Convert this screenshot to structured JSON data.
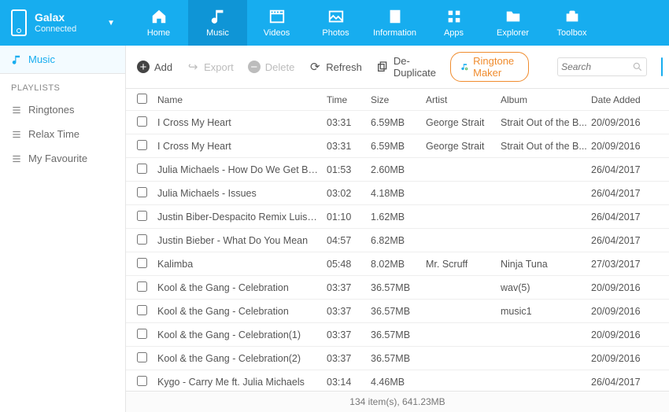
{
  "device": {
    "name": "Galax",
    "status": "Connected"
  },
  "nav": {
    "home": "Home",
    "music": "Music",
    "videos": "Videos",
    "photos": "Photos",
    "information": "Information",
    "apps": "Apps",
    "explorer": "Explorer",
    "toolbox": "Toolbox"
  },
  "sidebar": {
    "main": "Music",
    "heading": "PLAYLISTS",
    "items": [
      "Ringtones",
      "Relax Time",
      "My Favourite"
    ]
  },
  "toolbar": {
    "add": "Add",
    "export": "Export",
    "delete": "Delete",
    "refresh": "Refresh",
    "dedup": "De-Duplicate",
    "ringtone": "Ringtone Maker",
    "search_placeholder": "Search"
  },
  "columns": {
    "name": "Name",
    "time": "Time",
    "size": "Size",
    "artist": "Artist",
    "album": "Album",
    "date": "Date Added"
  },
  "rows": [
    {
      "name": "I Cross My Heart",
      "time": "03:31",
      "size": "6.59MB",
      "artist": "George Strait",
      "album": "Strait Out of the B...",
      "date": "20/09/2016"
    },
    {
      "name": "I Cross My Heart",
      "time": "03:31",
      "size": "6.59MB",
      "artist": "George Strait",
      "album": "Strait Out of the B...",
      "date": "20/09/2016"
    },
    {
      "name": "Julia Michaels - How Do We Get Ba...",
      "time": "01:53",
      "size": "2.60MB",
      "artist": "",
      "album": "",
      "date": "26/04/2017"
    },
    {
      "name": "Julia Michaels - Issues",
      "time": "03:02",
      "size": "4.18MB",
      "artist": "",
      "album": "",
      "date": "26/04/2017"
    },
    {
      "name": "Justin Biber-Despacito Remix Luis F...",
      "time": "01:10",
      "size": "1.62MB",
      "artist": "",
      "album": "",
      "date": "26/04/2017"
    },
    {
      "name": "Justin Bieber - What Do You Mean",
      "time": "04:57",
      "size": "6.82MB",
      "artist": "",
      "album": "",
      "date": "26/04/2017"
    },
    {
      "name": "Kalimba",
      "time": "05:48",
      "size": "8.02MB",
      "artist": "Mr. Scruff",
      "album": "Ninja Tuna",
      "date": "27/03/2017"
    },
    {
      "name": "Kool & the Gang - Celebration",
      "time": "03:37",
      "size": "36.57MB",
      "artist": "",
      "album": "wav(5)",
      "date": "20/09/2016"
    },
    {
      "name": "Kool & the Gang - Celebration",
      "time": "03:37",
      "size": "36.57MB",
      "artist": "",
      "album": "music1",
      "date": "20/09/2016"
    },
    {
      "name": "Kool & the Gang - Celebration(1)",
      "time": "03:37",
      "size": "36.57MB",
      "artist": "",
      "album": "",
      "date": "20/09/2016"
    },
    {
      "name": "Kool & the Gang - Celebration(2)",
      "time": "03:37",
      "size": "36.57MB",
      "artist": "",
      "album": "",
      "date": "20/09/2016"
    },
    {
      "name": "Kygo - Carry Me ft. Julia Michaels",
      "time": "03:14",
      "size": "4.46MB",
      "artist": "",
      "album": "",
      "date": "26/04/2017"
    }
  ],
  "status": "134 item(s), 641.23MB"
}
